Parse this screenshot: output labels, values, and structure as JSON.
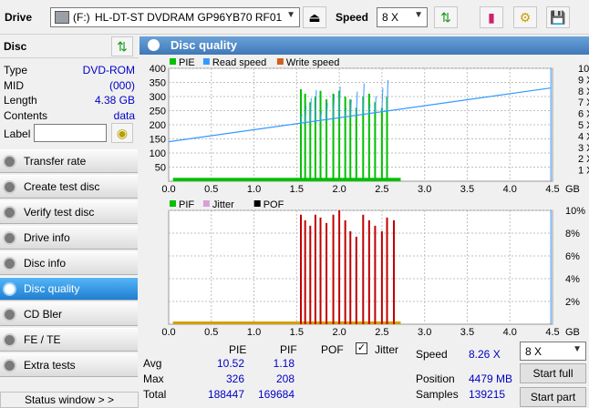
{
  "toolbar": {
    "drive_label": "Drive",
    "drive_letter": "(F:)",
    "drive_name": "HL-DT-ST DVDRAM GP96YB70 RF01",
    "speed_label": "Speed",
    "speed_value": "8 X"
  },
  "disc_panel": {
    "title": "Disc",
    "rows": [
      {
        "key": "Type",
        "value": "DVD-ROM"
      },
      {
        "key": "MID",
        "value": "(000)"
      },
      {
        "key": "Length",
        "value": "4.38 GB"
      },
      {
        "key": "Contents",
        "value": "data"
      }
    ],
    "label_key": "Label",
    "label_value": ""
  },
  "nav": [
    {
      "label": "Transfer rate",
      "active": false
    },
    {
      "label": "Create test disc",
      "active": false
    },
    {
      "label": "Verify test disc",
      "active": false
    },
    {
      "label": "Drive info",
      "active": false
    },
    {
      "label": "Disc info",
      "active": false
    },
    {
      "label": "Disc quality",
      "active": true
    },
    {
      "label": "CD Bler",
      "active": false
    },
    {
      "label": "FE / TE",
      "active": false
    },
    {
      "label": "Extra tests",
      "active": false
    }
  ],
  "status_window": "Status window > >",
  "panel_title": "Disc quality",
  "chart_data": [
    {
      "type": "line",
      "legend": [
        {
          "name": "PIE",
          "color": "#00c000"
        },
        {
          "name": "Read speed",
          "color": "#3399ff"
        },
        {
          "name": "Write speed",
          "color": "#d06020"
        }
      ],
      "xlim": [
        0,
        4.5
      ],
      "x_ticks": [
        "0.0",
        "0.5",
        "1.0",
        "1.5",
        "2.0",
        "2.5",
        "3.0",
        "3.5",
        "4.0",
        "4.5"
      ],
      "x_unit": "GB",
      "ylim": [
        0,
        400
      ],
      "y_ticks": [
        "400",
        "350",
        "300",
        "250",
        "200",
        "150",
        "100",
        "50"
      ],
      "y2_ticks": [
        "10 X",
        "9 X",
        "8 X",
        "7 X",
        "6 X",
        "5 X",
        "4 X",
        "3 X",
        "2 X",
        "1 X"
      ],
      "series": [
        {
          "name": "PIE",
          "baseline": 12,
          "baseline_x": [
            0.05,
            2.72
          ],
          "spikes": [
            [
              1.55,
              326
            ],
            [
              1.6,
              310
            ],
            [
              1.66,
              280
            ],
            [
              1.72,
              300
            ],
            [
              1.78,
              320
            ],
            [
              1.85,
              290
            ],
            [
              1.93,
              310
            ],
            [
              2.0,
              320
            ],
            [
              2.07,
              300
            ],
            [
              2.13,
              290
            ],
            [
              2.2,
              260
            ],
            [
              2.28,
              300
            ],
            [
              2.35,
              310
            ],
            [
              2.42,
              280
            ],
            [
              2.5,
              260
            ],
            [
              2.56,
              300
            ]
          ]
        },
        {
          "name": "Read speed",
          "start": 3.5,
          "end": 8.26,
          "x_end": 4.48
        }
      ]
    },
    {
      "type": "line",
      "legend": [
        {
          "name": "PIF",
          "color": "#00c000"
        },
        {
          "name": "Jitter",
          "color": "#d8a0d8"
        },
        {
          "name": "POF",
          "color": "#000000"
        }
      ],
      "xlim": [
        0,
        4.5
      ],
      "x_ticks": [
        "0.0",
        "0.5",
        "1.0",
        "1.5",
        "2.0",
        "2.5",
        "3.0",
        "3.5",
        "4.0",
        "4.5"
      ],
      "x_unit": "GB",
      "ylim": [
        0,
        208
      ],
      "y2_ticks": [
        "10%",
        "8%",
        "6%",
        "4%",
        "2%"
      ],
      "series": [
        {
          "name": "PIF",
          "spikes": [
            [
              1.55,
              200
            ],
            [
              1.6,
              190
            ],
            [
              1.66,
              180
            ],
            [
              1.72,
              200
            ],
            [
              1.78,
              195
            ],
            [
              1.85,
              185
            ],
            [
              1.93,
              200
            ],
            [
              2.0,
              208
            ],
            [
              2.07,
              190
            ],
            [
              2.13,
              170
            ],
            [
              2.2,
              160
            ],
            [
              2.28,
              200
            ],
            [
              2.35,
              190
            ],
            [
              2.42,
              180
            ],
            [
              2.5,
              170
            ],
            [
              2.56,
              195
            ],
            [
              2.64,
              190
            ]
          ]
        }
      ]
    }
  ],
  "stats": {
    "col_pie": "PIE",
    "col_pif": "PIF",
    "col_pof": "POF",
    "jitter_label": "Jitter",
    "jitter_checked": true,
    "rows": [
      {
        "label": "Avg",
        "pie": "10.52",
        "pif": "1.18"
      },
      {
        "label": "Max",
        "pie": "326",
        "pif": "208"
      },
      {
        "label": "Total",
        "pie": "188447",
        "pif": "169684"
      }
    ],
    "speed_label": "Speed",
    "speed_value": "8.26 X",
    "position_label": "Position",
    "position_value": "4479 MB",
    "samples_label": "Samples",
    "samples_value": "139215",
    "speed_select": "8 X",
    "start_full": "Start full",
    "start_part": "Start part"
  }
}
